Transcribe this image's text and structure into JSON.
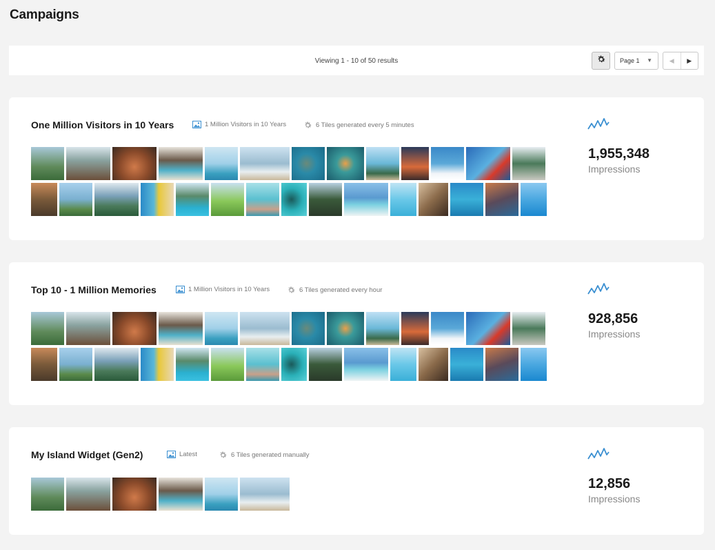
{
  "page": {
    "title": "Campaigns"
  },
  "toolbar": {
    "viewing_text": "Viewing 1 - 10 of 50 results",
    "page_select_value": "Page 1"
  },
  "campaigns": [
    {
      "title": "One Million Visitors in 10 Years",
      "source": "1 Million Visitors in 10 Years",
      "schedule": "6 Tiles generated every 5 minutes",
      "impressions_value": "1,955,348",
      "impressions_label": "Impressions"
    },
    {
      "title": "Top 10 - 1 Million Memories",
      "source": "1 Million Visitors in 10 Years",
      "schedule": "6 Tiles generated every hour",
      "impressions_value": "928,856",
      "impressions_label": "Impressions"
    },
    {
      "title": "My Island Widget (Gen2)",
      "source": "Latest",
      "schedule": "6 Tiles generated manually",
      "impressions_value": "12,856",
      "impressions_label": "Impressions"
    }
  ],
  "colors": {
    "accent": "#3a8fd1",
    "background": "#f3f3f3",
    "card": "#ffffff"
  },
  "icons": {
    "settings": "gear-icon",
    "source": "image-icon",
    "schedule": "cog-icon",
    "trend": "trend-line-icon",
    "prev": "triangle-left-icon",
    "next": "triangle-right-icon"
  }
}
